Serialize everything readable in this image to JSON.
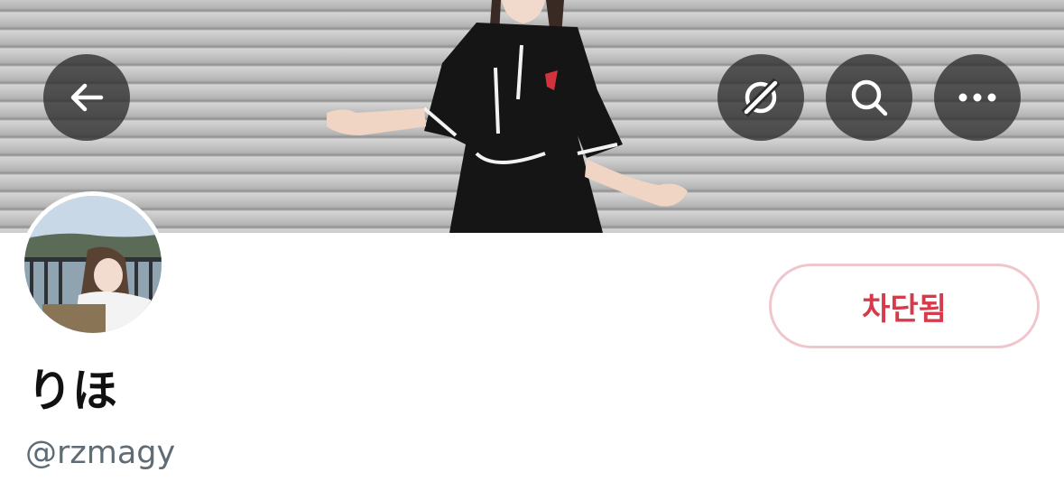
{
  "profile": {
    "display_name": "りほ",
    "handle": "@rzmagy",
    "blocked_label": "차단됨"
  },
  "header": {
    "back_icon": "arrow-left-icon",
    "translate_icon": "no-sync-icon",
    "search_icon": "search-icon",
    "more_icon": "more-horizontal-icon"
  },
  "colors": {
    "blocked_text": "#d63b4c",
    "blocked_border": "#f0c6cc",
    "handle_text": "#5f6b75",
    "nav_button_bg": "#2d2d2d"
  }
}
